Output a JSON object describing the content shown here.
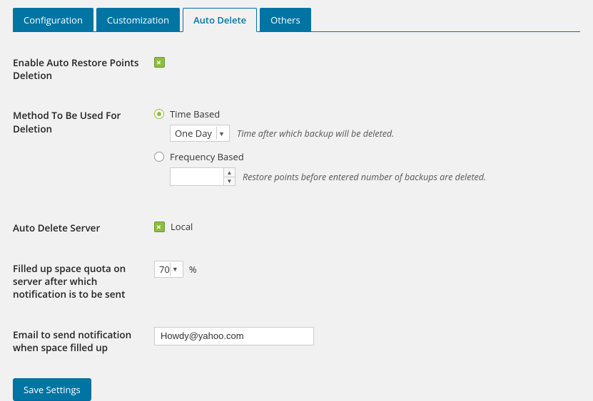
{
  "tabs": {
    "configuration": "Configuration",
    "customization": "Customization",
    "auto_delete": "Auto Delete",
    "others": "Others"
  },
  "fields": {
    "enable_label": "Enable Auto Restore Points Deletion",
    "method": {
      "label": "Method To Be Used For Deletion",
      "time_option": "Time Based",
      "time_select_value": "One Day",
      "time_hint": "Time after which backup will be deleted.",
      "freq_option": "Frequency Based",
      "freq_value": "",
      "freq_hint": "Restore points before entered number of backups are deleted."
    },
    "server": {
      "label": "Auto Delete Server",
      "option": "Local"
    },
    "quota": {
      "label": "Filled up space quota on server after which notification is to be sent",
      "value": "70",
      "unit": "%"
    },
    "email": {
      "label": "Email to send notification when space filled up",
      "value": "Howdy@yahoo.com"
    }
  },
  "save_button": "Save Settings"
}
